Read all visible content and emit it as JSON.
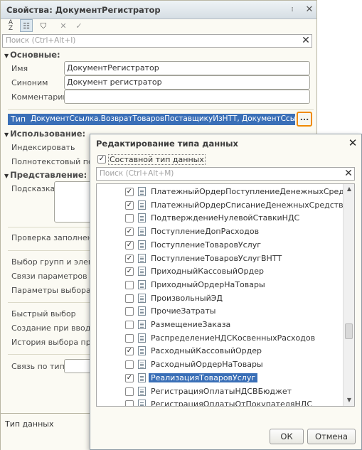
{
  "props_window": {
    "title": "Свойства: ДокументРегистратор",
    "search_placeholder": "Поиск (Ctrl+Alt+I)",
    "sections": {
      "main": "Основные:",
      "usage": "Использование:",
      "presentation": "Представление:"
    },
    "fields": {
      "name_label": "Имя",
      "name_value": "ДокументРегистратор",
      "synonym_label": "Синоним",
      "synonym_value": "Документ регистратор",
      "comment_label": "Комментарий",
      "comment_value": "",
      "type_label": "Тип",
      "type_value": "ДокументСсылка.ВозвратТоваровПоставщикуИзНТТ, ДокументСсылка",
      "ellipsis": "..."
    },
    "usage_labels": {
      "indexing": "Индексировать",
      "fulltext": "Полнотекстовый поиск"
    },
    "presentation_labels": {
      "hint": "Подсказка"
    },
    "other_labels": {
      "fill_check": "Проверка заполнения",
      "group_select": "Выбор групп и элементов",
      "param_links": "Связи параметров выбора",
      "select_params": "Параметры выбора",
      "quick_select": "Быстрый выбор",
      "create_on_input": "Создание при вводе",
      "history": "История выбора при вводе",
      "link_by_type": "Связь по типу"
    },
    "bottom_text": "Тип данных"
  },
  "dialog": {
    "title": "Редактирование типа данных",
    "composite_label": "Составной тип данных",
    "composite_checked": true,
    "search_placeholder": "Поиск (Ctrl+Alt+M)",
    "items": [
      {
        "label": "ПлатежныйОрдерПоступлениеДенежныхСредств",
        "checked": true,
        "selected": false
      },
      {
        "label": "ПлатежныйОрдерСписаниеДенежныхСредств",
        "checked": true,
        "selected": false
      },
      {
        "label": "ПодтверждениеНулевойСтавкиНДС",
        "checked": false,
        "selected": false
      },
      {
        "label": "ПоступлениеДопРасходов",
        "checked": true,
        "selected": false
      },
      {
        "label": "ПоступлениеТоваровУслуг",
        "checked": true,
        "selected": false
      },
      {
        "label": "ПоступлениеТоваровУслугВНТТ",
        "checked": true,
        "selected": false
      },
      {
        "label": "ПриходныйКассовыйОрдер",
        "checked": true,
        "selected": false
      },
      {
        "label": "ПриходныйОрдерНаТовары",
        "checked": false,
        "selected": false
      },
      {
        "label": "ПроизвольныйЭД",
        "checked": false,
        "selected": false
      },
      {
        "label": "ПрочиеЗатраты",
        "checked": false,
        "selected": false
      },
      {
        "label": "РазмещениеЗаказа",
        "checked": false,
        "selected": false
      },
      {
        "label": "РаспределениеНДСКосвенныхРасходов",
        "checked": false,
        "selected": false
      },
      {
        "label": "РасходныйКассовыйОрдер",
        "checked": true,
        "selected": false
      },
      {
        "label": "РасходныйОрдерНаТовары",
        "checked": false,
        "selected": false
      },
      {
        "label": "РеализацияТоваровУслуг",
        "checked": true,
        "selected": true
      },
      {
        "label": "РегистрацияОплатыНДСВБюджет",
        "checked": false,
        "selected": false
      },
      {
        "label": "РегистрацияОплатыОтПокупателяНДС",
        "checked": false,
        "selected": false
      }
    ],
    "ok_label": "ОК",
    "cancel_label": "Отмена"
  }
}
